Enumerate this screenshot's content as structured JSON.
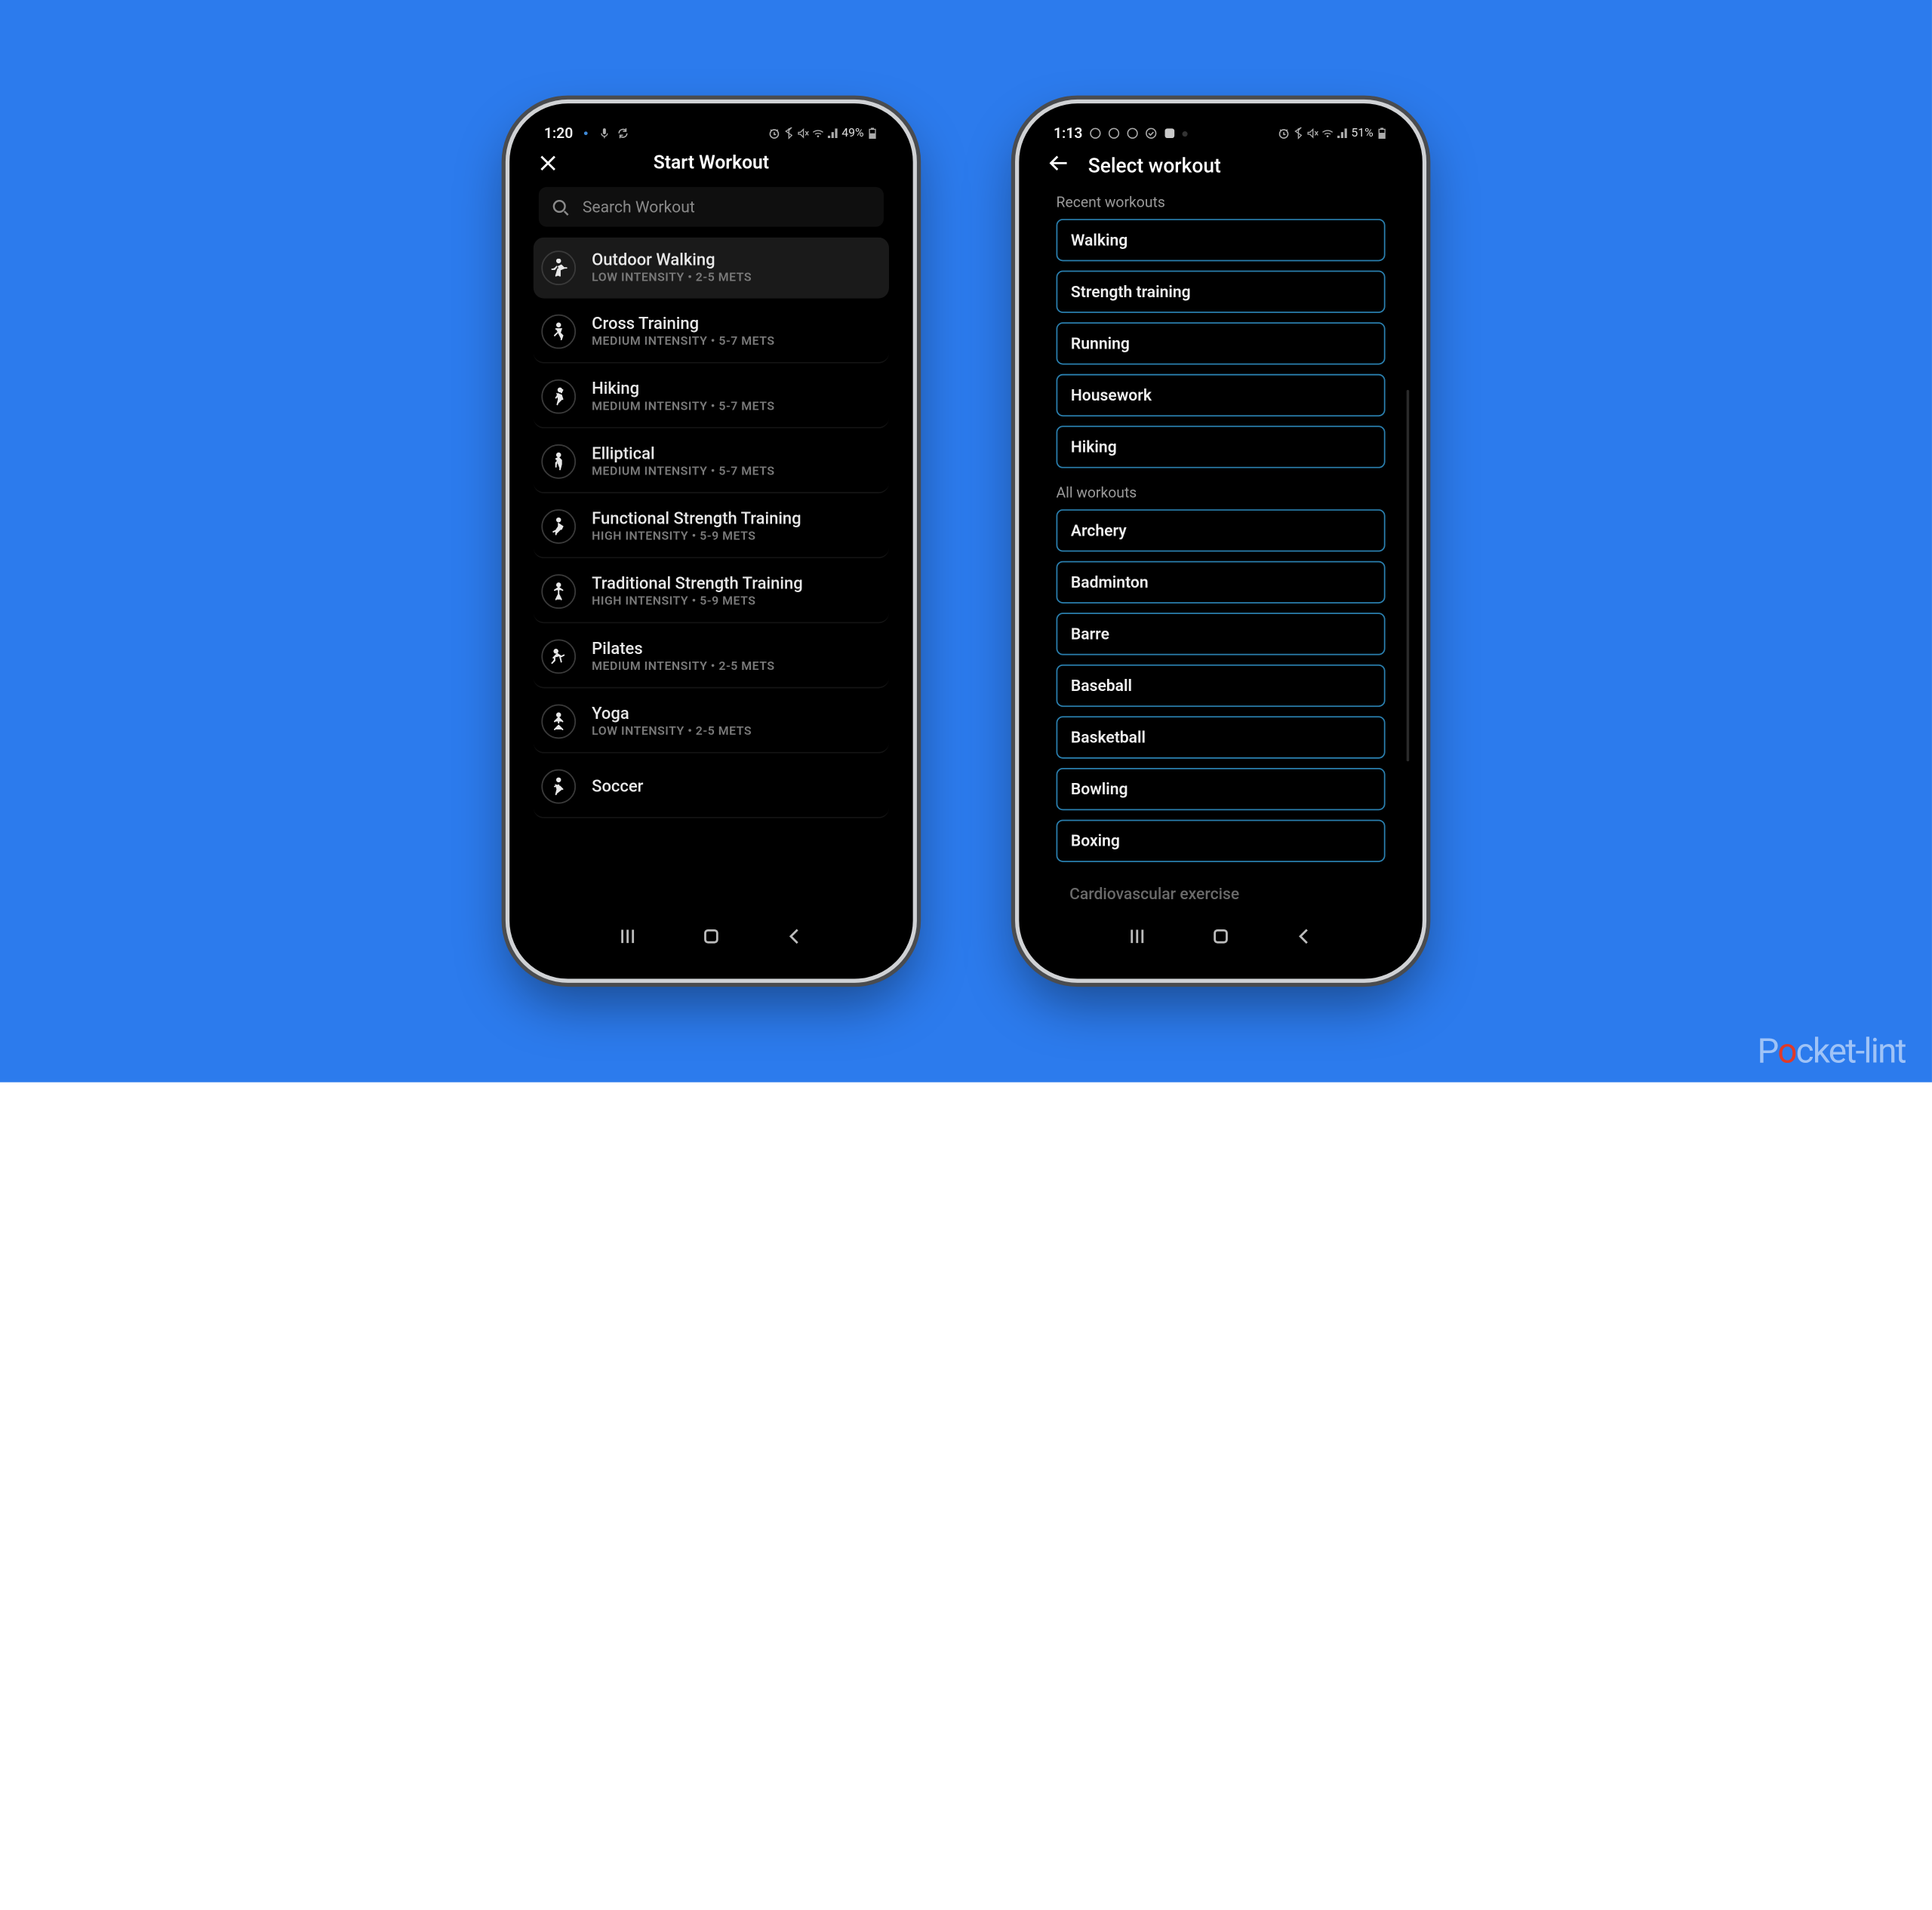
{
  "watermark": {
    "pre": "P",
    "o": "o",
    "post": "cket-lint"
  },
  "phone1": {
    "status": {
      "time": "1:20",
      "battery": "49%"
    },
    "header": {
      "title": "Start Workout"
    },
    "search": {
      "placeholder": "Search Workout"
    },
    "workouts": [
      {
        "title": "Outdoor Walking",
        "sub": "LOW INTENSITY • 2-5 METS",
        "selected": true
      },
      {
        "title": "Cross Training",
        "sub": "MEDIUM INTENSITY • 5-7 METS",
        "selected": false
      },
      {
        "title": "Hiking",
        "sub": "MEDIUM INTENSITY • 5-7 METS",
        "selected": false
      },
      {
        "title": "Elliptical",
        "sub": "MEDIUM INTENSITY • 5-7 METS",
        "selected": false
      },
      {
        "title": "Functional Strength Training",
        "sub": "HIGH INTENSITY • 5-9 METS",
        "selected": false
      },
      {
        "title": "Traditional Strength Training",
        "sub": "HIGH INTENSITY • 5-9 METS",
        "selected": false
      },
      {
        "title": "Pilates",
        "sub": "MEDIUM INTENSITY • 2-5 METS",
        "selected": false
      },
      {
        "title": "Yoga",
        "sub": "LOW INTENSITY • 2-5 METS",
        "selected": false
      },
      {
        "title": "Soccer",
        "sub": "",
        "selected": false
      }
    ]
  },
  "phone2": {
    "status": {
      "time": "1:13",
      "battery": "51%"
    },
    "header": {
      "title": "Select workout"
    },
    "section_recent": "Recent workouts",
    "recent": [
      "Walking",
      "Strength training",
      "Running",
      "Housework",
      "Hiking"
    ],
    "section_all": "All workouts",
    "all": [
      "Archery",
      "Badminton",
      "Barre",
      "Baseball",
      "Basketball",
      "Bowling",
      "Boxing"
    ],
    "cutoff": "Cardiovascular exercise"
  }
}
